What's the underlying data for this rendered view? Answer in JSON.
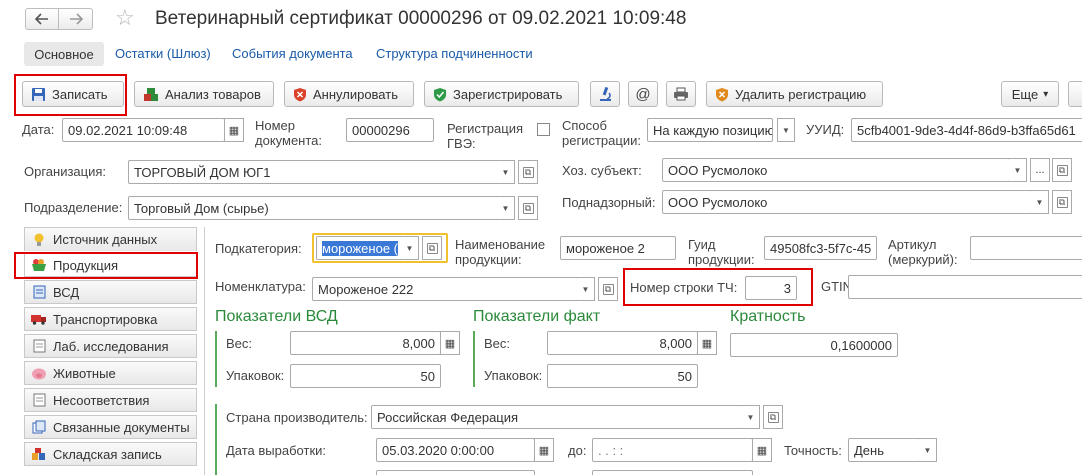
{
  "window": {
    "title": "Ветеринарный сертификат 00000296 от 09.02.2021 10:09:48"
  },
  "nav_tabs": [
    {
      "label": "Основное"
    },
    {
      "label": "Остатки (Шлюз)"
    },
    {
      "label": "События документа"
    },
    {
      "label": "Структура подчиненности"
    }
  ],
  "toolbar": {
    "save": "Записать",
    "analysis": "Анализ товаров",
    "cancel": "Аннулировать",
    "register": "Зарегистрировать",
    "delete_reg": "Удалить регистрацию",
    "more": "Еще",
    "more_arrow": "▾"
  },
  "header": {
    "date_label": "Дата:",
    "date_value": "09.02.2021 10:09:48",
    "docnum_label_1": "Номер",
    "docnum_label_2": "документа:",
    "docnum_value": "00000296",
    "gve_label_1": "Регистрация",
    "gve_label_2": "ГВЭ:",
    "method_label_1": "Способ",
    "method_label_2": "регистрации:",
    "method_value": "На каждую позицию",
    "uuid_label": "УУИД:",
    "uuid_value": "5cfb4001-9de3-4d4f-86d9-b3ffa65d61",
    "org_label": "Организация:",
    "org_value": "ТОРГОВЫЙ ДОМ ЮГ1",
    "sub_label": "Подразделение:",
    "sub_value": "Торговый Дом (сырье)",
    "hoz_label": "Хоз. субъект:",
    "hoz_value": "ООО Русмолоко",
    "nadzor_label": "Поднадзорный:",
    "nadzor_value": "ООО Русмолоко",
    "ellipsis": "..."
  },
  "side_tabs": [
    {
      "label": "Источник данных"
    },
    {
      "label": "Продукция"
    },
    {
      "label": "ВСД"
    },
    {
      "label": "Транспортировка"
    },
    {
      "label": "Лаб. исследования"
    },
    {
      "label": "Животные"
    },
    {
      "label": "Несоответствия"
    },
    {
      "label": "Связанные документы"
    },
    {
      "label": "Складская запись"
    }
  ],
  "product": {
    "subcat_label": "Подкатегория:",
    "subcat_value": "мороженое (",
    "name_label_1": "Наименование",
    "name_label_2": "продукции:",
    "name_value": "мороженое 2",
    "guid_label_1": "Гуид",
    "guid_label_2": "продукции:",
    "guid_value": "49508fc3-5f7c-45",
    "article_label_1": "Артикул",
    "article_label_2": "(меркурий):",
    "article_value": "",
    "nom_label": "Номенклатура:",
    "nom_value": "Мороженое 222",
    "rownum_label": "Номер строки ТЧ:",
    "rownum_value": "3",
    "gtin_label": "GTIN:"
  },
  "indicators": {
    "vsd_title": "Показатели ВСД",
    "fact_title": "Показатели факт",
    "mult_title": "Кратность",
    "weight_label": "Вес:",
    "packs_label": "Упаковок:",
    "vsd_weight": "8,000",
    "vsd_packs": "50",
    "fact_weight": "8,000",
    "fact_packs": "50",
    "mult_value": "0,1600000"
  },
  "production": {
    "country_label": "Страна производитель:",
    "country_value": "Российская Федерация",
    "date_label": "Дата выработки:",
    "date_value": "05.03.2020  0:00:00",
    "to_label": "до:",
    "to_value": " .  .     :  :",
    "acc_label": "Точность:",
    "acc_value": "День"
  },
  "colors": {
    "accent_green": "#2a8a3a",
    "highlight_red": "#e00000",
    "link_blue": "#1a5aa8",
    "selection_blue": "#3a78d8"
  }
}
